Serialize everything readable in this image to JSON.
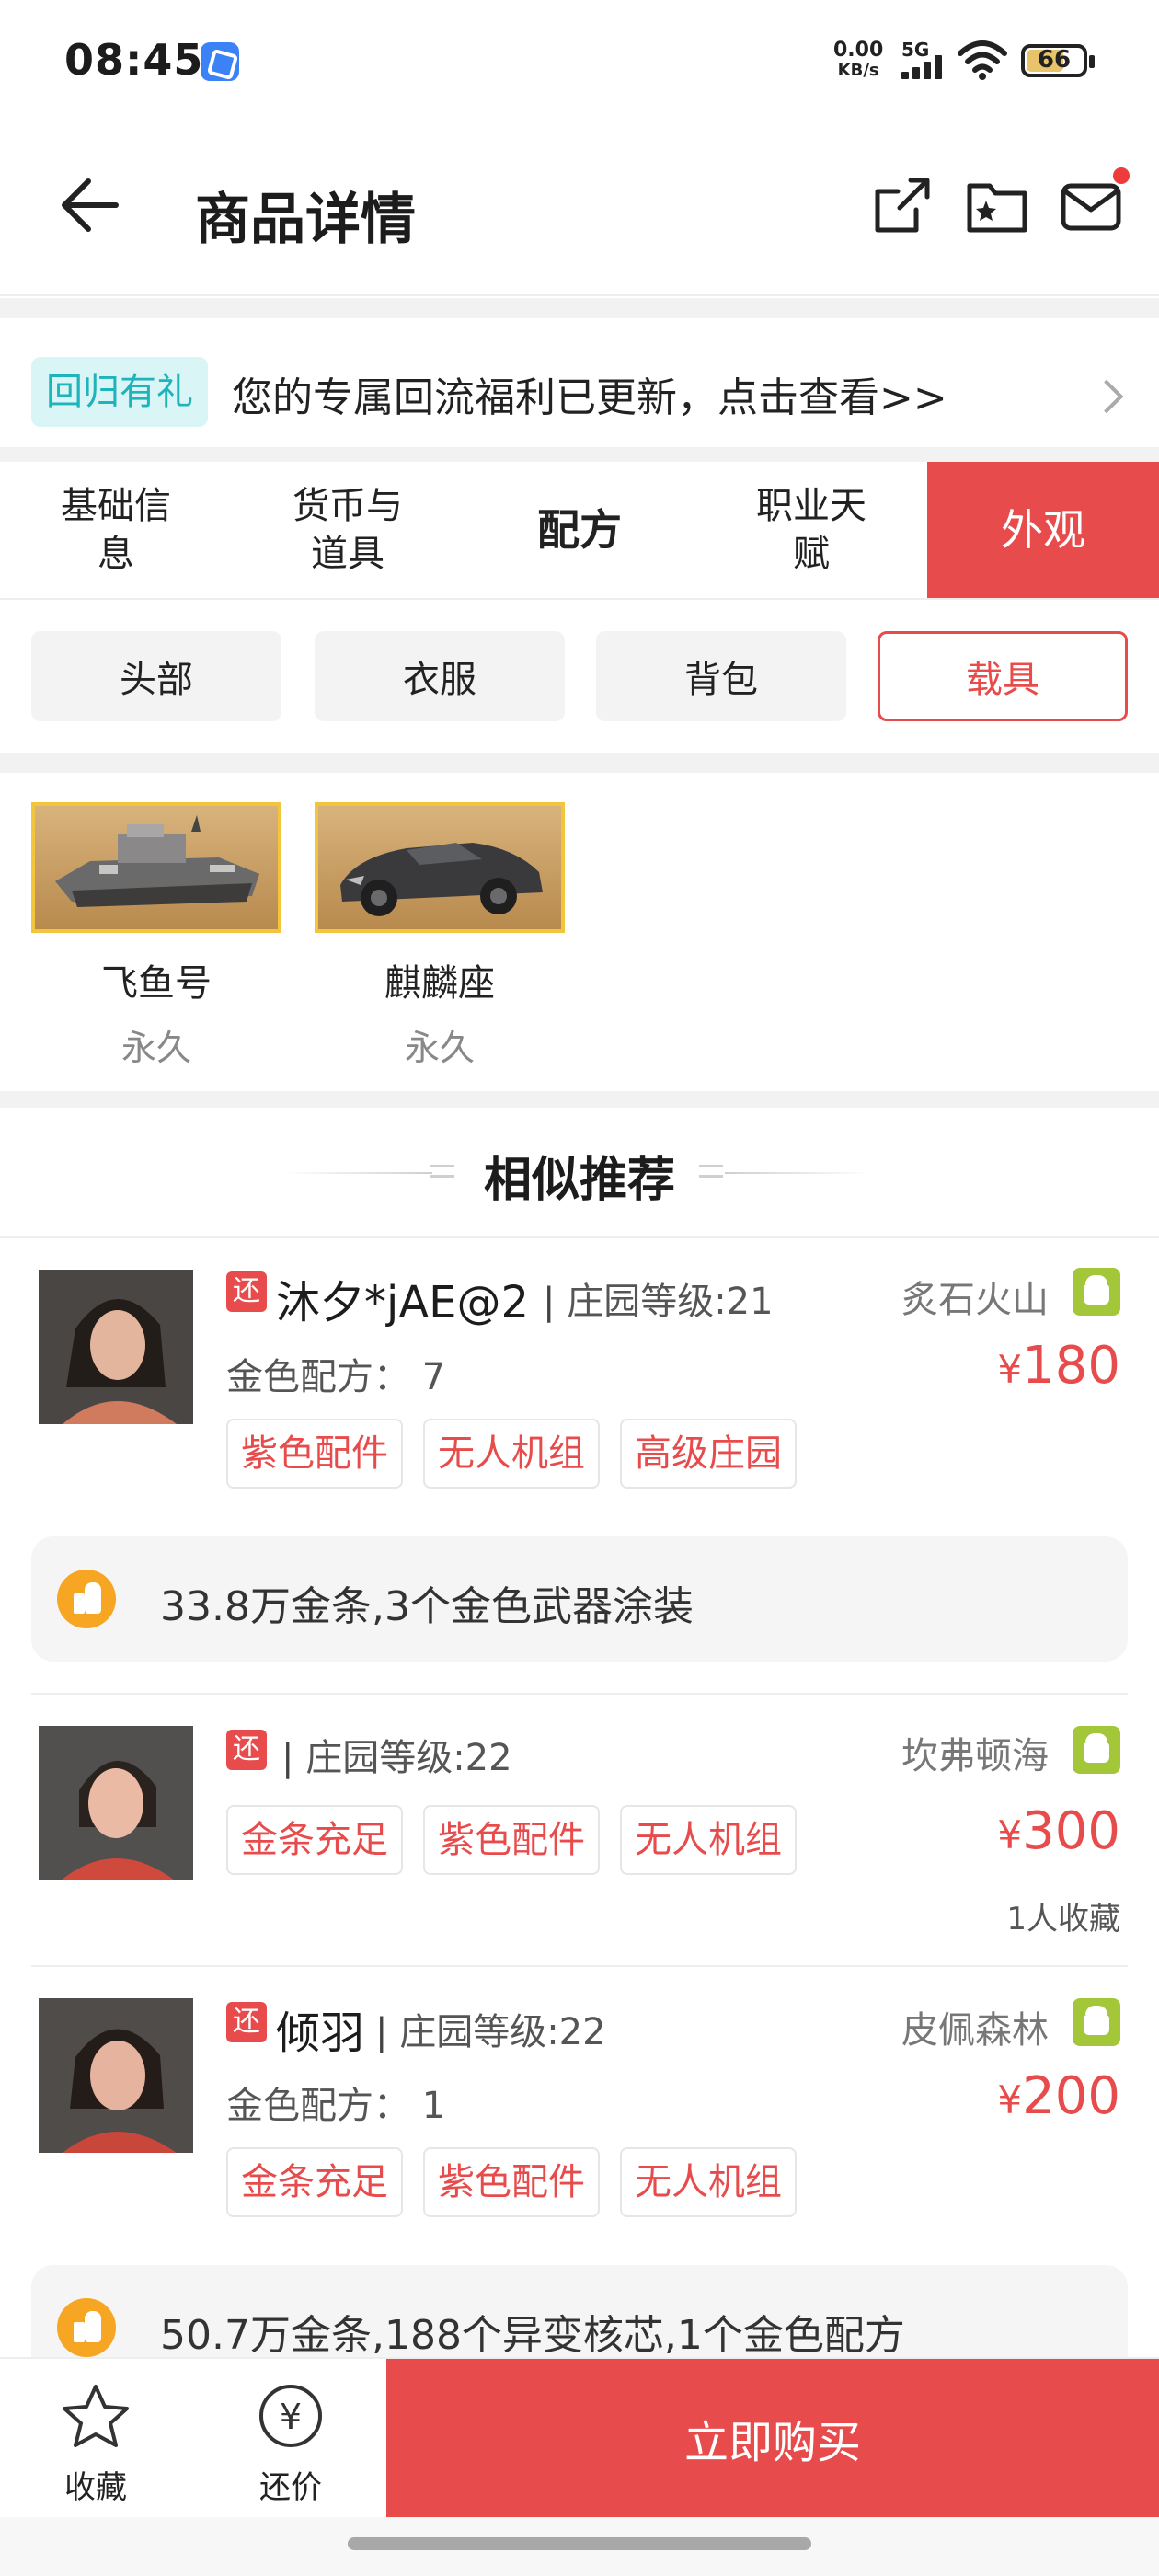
{
  "status_bar": {
    "time": "08:45",
    "net_speed_value": "0.00",
    "net_speed_unit": "KB/s",
    "network_type": "5G",
    "battery": "66"
  },
  "header": {
    "title": "商品详情",
    "icons": [
      "back-arrow-icon",
      "share-icon",
      "folder-star-icon",
      "mail-icon"
    ]
  },
  "banner": {
    "tag": "回归有礼",
    "text": "您的专属回流福利已更新，点击查看>>"
  },
  "tabs": [
    {
      "label": "基础信\n息",
      "active": false
    },
    {
      "label": "货币与\n道具",
      "active": false
    },
    {
      "label": "配方",
      "active": false
    },
    {
      "label": "职业天\n赋",
      "active": false
    },
    {
      "label": "外观",
      "active": true
    }
  ],
  "subtabs": [
    {
      "label": "头部",
      "active": false
    },
    {
      "label": "衣服",
      "active": false
    },
    {
      "label": "背包",
      "active": false
    },
    {
      "label": "载具",
      "active": true
    }
  ],
  "items": [
    {
      "name": "飞鱼号",
      "duration": "永久"
    },
    {
      "name": "麒麟座",
      "duration": "永久"
    }
  ],
  "section": {
    "title": "相似推荐"
  },
  "listings": [
    {
      "badge": "还",
      "name": "沐夕*jAE@2",
      "level": "庄园等级:21",
      "server": "炙石火山",
      "sub": "金色配方：  7",
      "price_symbol": "¥",
      "price": "180",
      "tags": [
        "紫色配件",
        "无人机组",
        "高级庄园"
      ],
      "highlight": "33.8万金条,3个金色武器涂装"
    },
    {
      "badge": "还",
      "name": "",
      "level": "庄园等级:22",
      "server": "坎弗顿海",
      "price_symbol": "¥",
      "price": "300",
      "favorites": "1人收藏",
      "tags": [
        "金条充足",
        "紫色配件",
        "无人机组"
      ]
    },
    {
      "badge": "还",
      "name": "倾羽",
      "level": "庄园等级:22",
      "server": "皮佩森林",
      "sub": "金色配方：  1",
      "price_symbol": "¥",
      "price": "200",
      "tags": [
        "金条充足",
        "紫色配件",
        "无人机组"
      ],
      "highlight": "50.7万金条,188个异变核芯,1个金色配方"
    }
  ],
  "bottom_bar": {
    "favorite_label": "收藏",
    "bargain_label": "还价",
    "bargain_symbol": "¥",
    "buy_label": "立即购买"
  },
  "colors": {
    "accent": "#e84b4b",
    "banner_tag_bg": "#d9f5f6",
    "banner_tag_text": "#1fb3bb",
    "item_border": "#f2c53d"
  }
}
